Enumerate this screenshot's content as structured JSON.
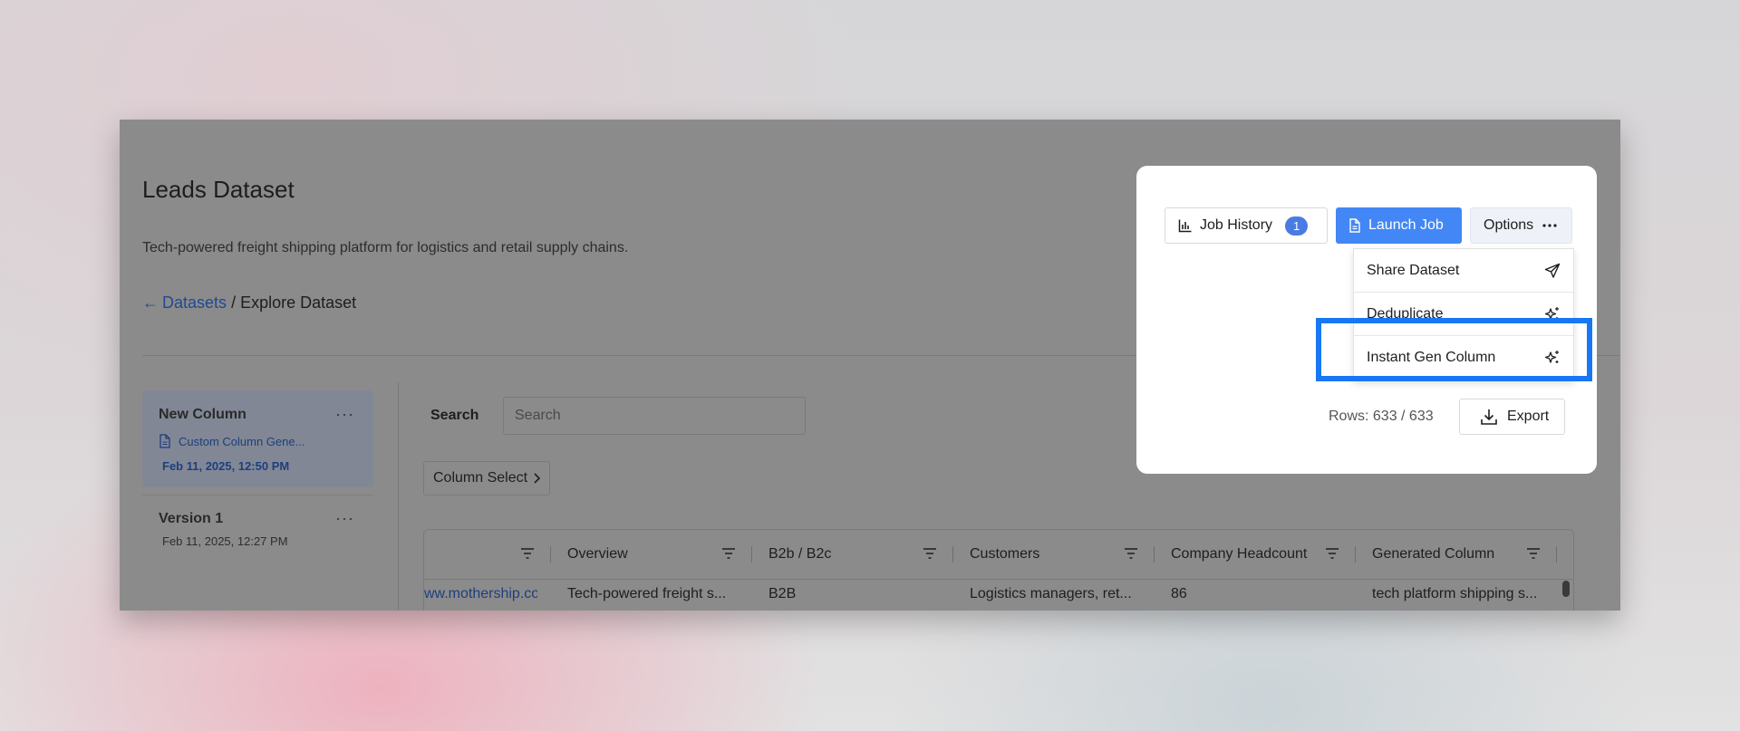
{
  "page": {
    "title": "Leads Dataset",
    "description": "Tech-powered freight shipping platform for logistics and retail supply chains.",
    "breadcrumb": {
      "back_link": "Datasets",
      "separator": "/",
      "current": "Explore Dataset"
    }
  },
  "versions": [
    {
      "title": "New Column",
      "subtitle": "Custom Column Gene...",
      "date": "Feb 11, 2025, 12:50 PM",
      "selected": true
    },
    {
      "title": "Version 1",
      "date": "Feb 11, 2025, 12:27 PM",
      "selected": false
    }
  ],
  "search": {
    "label": "Search",
    "placeholder": "Search"
  },
  "column_select": {
    "label": "Column Select"
  },
  "table": {
    "headers": [
      "",
      "Overview",
      "B2b / B2c",
      "Customers",
      "Company Headcount",
      "Generated Column"
    ],
    "rows": [
      [
        "ww.mothership.co",
        "Tech-powered freight s...",
        "B2B",
        "Logistics managers, ret...",
        "86",
        "tech platform shipping s..."
      ]
    ]
  },
  "toolbar": {
    "job_history_label": "Job History",
    "job_history_count": "1",
    "launch_job_label": "Launch Job",
    "options_label": "Options",
    "options_menu": [
      {
        "label": "Share Dataset",
        "icon": "send-icon"
      },
      {
        "label": "Deduplicate",
        "icon": "sparkle-icon"
      },
      {
        "label": "Instant Gen Column",
        "icon": "sparkle-icon"
      }
    ]
  },
  "rows_info": "Rows: 633 / 633",
  "export_label": "Export",
  "colors": {
    "accent": "#4287f5",
    "highlight": "#1877f2",
    "badge": "#4a7be2"
  }
}
